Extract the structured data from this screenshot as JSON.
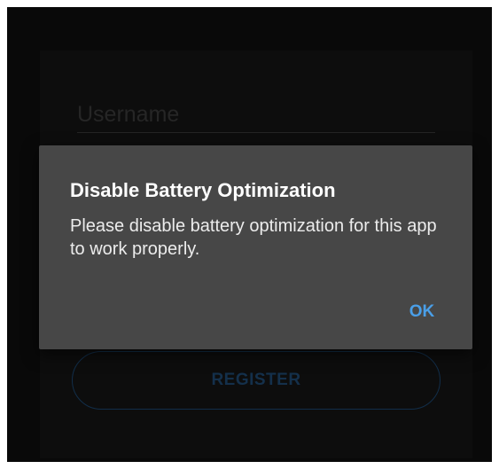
{
  "login_form": {
    "username_placeholder": "Username",
    "username_value": "",
    "register_label": "REGISTER"
  },
  "dialog": {
    "title": "Disable Battery Optimization",
    "message": "Please disable battery optimization for this app to work properly.",
    "ok_label": "OK"
  },
  "colors": {
    "screen_background": "#0f0f0f",
    "dialog_background": "#474747",
    "accent": "#4a9fe8",
    "register_outline": "#1c4872"
  }
}
